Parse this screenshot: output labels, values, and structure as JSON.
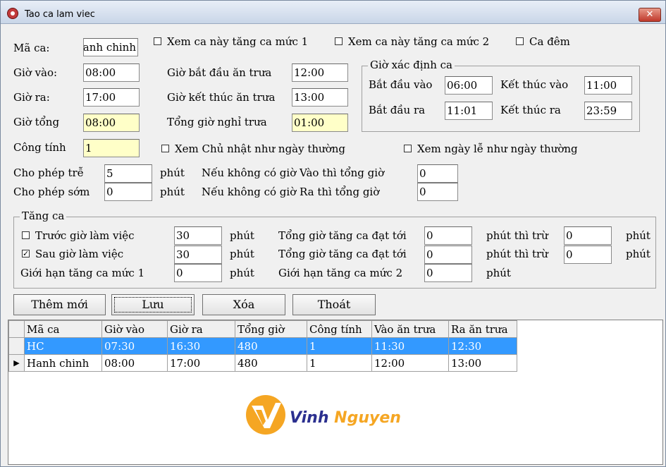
{
  "window": {
    "title": "Tao ca lam viec",
    "close_label": "✕"
  },
  "shift": {
    "ma_ca_label": "Mã ca:",
    "ma_ca_value": "Hanh chinh",
    "gio_vao_label": "Giờ vào:",
    "gio_vao_value": "08:00",
    "gio_ra_label": "Giờ ra:",
    "gio_ra_value": "17:00",
    "gio_tong_label": "Giờ tổng",
    "gio_tong_value": "08:00",
    "cong_tinh_label": "Công tính",
    "cong_tinh_value": "1",
    "lunch_start_label": "Giờ bắt đầu ăn trưa",
    "lunch_start_value": "12:00",
    "lunch_end_label": "Giờ kết thúc ăn trưa",
    "lunch_end_value": "13:00",
    "lunch_total_label": "Tổng giờ nghỉ trưa",
    "lunch_total_value": "01:00"
  },
  "options": {
    "overtime1_label": "Xem ca này tăng ca mức 1",
    "overtime1_checked": false,
    "overtime2_label": "Xem ca này tăng ca mức 2",
    "overtime2_checked": false,
    "night_label": "Ca đêm",
    "night_checked": false,
    "sunday_label": "Xem Chủ nhật như ngày thường",
    "sunday_checked": false,
    "holiday_label": "Xem ngày lễ như ngày thường",
    "holiday_checked": false
  },
  "determine": {
    "caption": "Giờ xác định ca",
    "start_in_label": "Bắt đầu vào",
    "start_in_value": "06:00",
    "end_in_label": "Kết thúc vào",
    "end_in_value": "11:00",
    "start_out_label": "Bắt đầu ra",
    "start_out_value": "11:01",
    "end_out_label": "Kết thúc ra",
    "end_out_value": "23:59"
  },
  "allow": {
    "late_label": "Cho phép trễ",
    "late_value": "5",
    "early_label": "Cho phép sớm",
    "early_value": "0",
    "unit": "phút",
    "no_in_label": "Nếu không có giờ Vào thì tổng giờ",
    "no_in_value": "0",
    "no_out_label": "Nếu không có giờ Ra thì tổng giờ",
    "no_out_value": "0"
  },
  "overtime": {
    "caption": "Tăng ca",
    "before_label": "Trước giờ làm việc",
    "before_checked": false,
    "before_value": "30",
    "after_label": "Sau giờ làm việc",
    "after_checked": true,
    "after_value": "30",
    "unit": "phút",
    "reach_label": "Tổng giờ tăng ca đạt tới",
    "reach1_value": "0",
    "reach2_value": "0",
    "deduct_label": "phút thì trừ",
    "deduct1_value": "0",
    "deduct2_value": "0",
    "limit1_label": "Giới hạn tăng  ca mức 1",
    "limit1_value": "0",
    "limit2_label": "Giới hạn tăng ca mức 2",
    "limit2_value": "0"
  },
  "buttons": {
    "add": "Thêm mới",
    "save": "Lưu",
    "delete": "Xóa",
    "exit": "Thoát"
  },
  "table": {
    "columns": [
      "Mã ca",
      "Giờ vào",
      "Giờ ra",
      "Tổng giờ",
      "Công tính",
      "Vào ăn trưa",
      "Ra ăn trưa"
    ],
    "rows": [
      [
        "HC",
        "07:30",
        "16:30",
        "480",
        "1",
        "11:30",
        "12:30"
      ],
      [
        "Hanh chinh",
        "08:00",
        "17:00",
        "480",
        "1",
        "12:00",
        "13:00"
      ]
    ],
    "current_row_marker": "▶"
  },
  "logo": {
    "text": "Vinh Nguyen",
    "color": "#f5a623",
    "ink": "#2b2f8f"
  }
}
